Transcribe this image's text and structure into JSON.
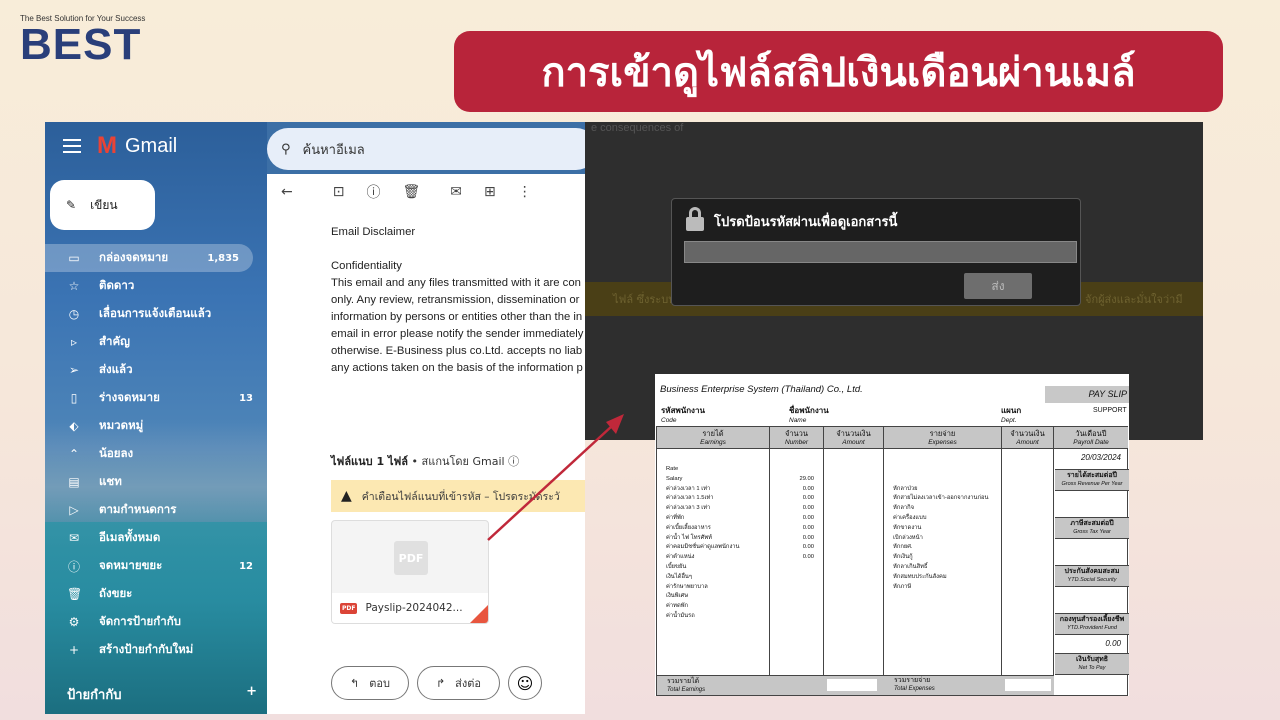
{
  "logo": {
    "tagline": "The Best Solution for Your Success",
    "word": "BEST"
  },
  "banner": {
    "title": "การเข้าดูไฟล์สลิปเงินเดือนผ่านเมล์"
  },
  "gmail": {
    "app_name": "Gmail",
    "search_placeholder": "ค้นหาอีเมล",
    "compose_label": "เขียน",
    "nav": [
      {
        "icon": "inbox-icon",
        "glyph": "▭",
        "label": "กล่องจดหมาย",
        "count": "1,835"
      },
      {
        "icon": "star-icon",
        "glyph": "☆",
        "label": "ติดดาว",
        "count": ""
      },
      {
        "icon": "clock-icon",
        "glyph": "◷",
        "label": "เลื่อนการแจ้งเตือนแล้ว",
        "count": ""
      },
      {
        "icon": "important-icon",
        "glyph": "▹",
        "label": "สำคัญ",
        "count": ""
      },
      {
        "icon": "send-icon",
        "glyph": "➢",
        "label": "ส่งแล้ว",
        "count": ""
      },
      {
        "icon": "draft-icon",
        "glyph": "▯",
        "label": "ร่างจดหมาย",
        "count": "13"
      },
      {
        "icon": "label-icon",
        "glyph": "⬖",
        "label": "หมวดหมู่",
        "count": ""
      },
      {
        "icon": "chevron-up-icon",
        "glyph": "⌃",
        "label": "น้อยลง",
        "count": ""
      },
      {
        "icon": "chat-icon",
        "glyph": "▤",
        "label": "แชท",
        "count": ""
      },
      {
        "icon": "scheduled-icon",
        "glyph": "▷",
        "label": "ตามกำหนดการ",
        "count": ""
      },
      {
        "icon": "all-mail-icon",
        "glyph": "✉",
        "label": "อีเมลทั้งหมด",
        "count": ""
      },
      {
        "icon": "spam-icon",
        "glyph": "ⓘ",
        "label": "จดหมายขยะ",
        "count": "12"
      },
      {
        "icon": "trash-icon",
        "glyph": "🗑",
        "label": "ถังขยะ",
        "count": ""
      },
      {
        "icon": "settings-icon",
        "glyph": "⚙",
        "label": "จัดการป้ายกำกับ",
        "count": ""
      },
      {
        "icon": "plus-icon",
        "glyph": "+",
        "label": "สร้างป้ายกำกับใหม่",
        "count": ""
      }
    ],
    "labels_title": "ป้ายกำกับ",
    "labels_add": "+",
    "email_lines": [
      "Email Disclaimer",
      "",
      "Confidentiality",
      "This email and any files transmitted with it are con",
      "only. Any review, retransmission, dissemination or",
      "information by persons or entities other than the in",
      "email in error please notify the sender immediately",
      "otherwise. E-Business plus co.Ltd. accepts no liab",
      "any actions taken on the basis of the information p"
    ],
    "attachment_header": "ไฟล์แนบ 1 ไฟล์",
    "attachment_scan": " • สแกนโดย Gmail ⓘ",
    "warning_text": "คำเตือนไฟล์แนบที่เข้ารหัส – โปรดระมัดระวั",
    "attachment_filename": "Payslip-2024042...",
    "attachment_thumb": "PDF",
    "pdf_badge": "PDF",
    "reply_label": "ตอบ",
    "forward_label": "ส่งต่อ"
  },
  "overlay": {
    "bg_text": "e consequences of",
    "band_left": "ไฟล์ ซึ่งระบบไม่สามารถ",
    "band_right": "จักผู้ส่งและมั่นใจว่ามี",
    "dialog_title": "โปรดป้อนรหัสผ่านเพื่อดูเอกสารนี้",
    "submit_label": "ส่ง"
  },
  "payslip": {
    "company": "Business Enterprise System (Thailand) Co., Ltd.",
    "title": "PAY SLIP",
    "code_th": "รหัสพนักงาน",
    "code_en": "Code",
    "name_th": "ชื่อพนักงาน",
    "name_en": "Name",
    "dept_th": "แผนก",
    "dept_en": "Dept.",
    "dept_value": "SUPPORT",
    "headers": [
      {
        "th": "รายได้",
        "en": "Earnings"
      },
      {
        "th": "จำนวน",
        "en": "Number"
      },
      {
        "th": "จำนวนเงิน",
        "en": "Amount"
      },
      {
        "th": "รายจ่าย",
        "en": "Expenses"
      },
      {
        "th": "จำนวนเงิน",
        "en": "Amount"
      },
      {
        "th": "วันเดือนปี",
        "en": "Payroll Date"
      }
    ],
    "earnings": "Rate\nSalary\nค่าล่วงเวลา 1 เท่า\nค่าล่วงเวลา 1.5เท่า\nค่าล่วงเวลา 3 เท่า\nค่าที่พัก\nค่าเบี้ยเลี้ยงอาหาร\nค่าน้ำ ไฟ โทรศัพท์\nค่าคอมมิชชั่นค่าดูแลพนักงาน\nค่าตำแหน่ง\nเบี้ยขยัน\nเงินได้อื่นๆ\nค่ารักษาพยาบาล\nเงินพิเศษ\nค่าทดพัก\nค่าน้ำมันรถ",
    "numbers": "\n29.00\n0.00\n0.00\n0.00\n0.00\n0.00\n0.00\n0.00\n0.00",
    "expenses": "\n\nหักลาป่วย\nหักสายไม่ลงเวลาเข้า-ออกจากงานก่อน\nหักลากิจ\nค่าเครื่องแบบ\nหักขาดงาน\nเบิกล่วงหน้า\nหักกยศ.\nหักเงินกู้\nหักลาเกินสิทธิ์\nหักสมทบประกันสังคม\nหักภาษี",
    "payroll_date": "20/03/2024",
    "side": [
      {
        "th": "รายได้สะสมต่อปี",
        "en": "Gross Revenue Per Year",
        "value": ""
      },
      {
        "th": "ภาษีสะสมต่อปี",
        "en": "Gross Tax Year",
        "value": ""
      },
      {
        "th": "ประกันสังคมสะสม",
        "en": "YTD.Social Security",
        "value": ""
      },
      {
        "th": "กองทุนสำรองเลี้ยงชีพ",
        "en": "YTD.Provident Fund",
        "value": "0.00"
      },
      {
        "th": "เงินรับสุทธิ",
        "en": "Net To Pay",
        "value": ""
      }
    ],
    "total_earnings_th": "รวมรายได้",
    "total_earnings_en": "Total Earnings",
    "total_expenses_th": "รวมรายจ่าย",
    "total_expenses_en": "Total Expenses"
  },
  "colors": {
    "banner": "#b8243a",
    "logo": "#2a3f7a",
    "arrow": "#c0283a",
    "warning": "#fce8b2"
  }
}
